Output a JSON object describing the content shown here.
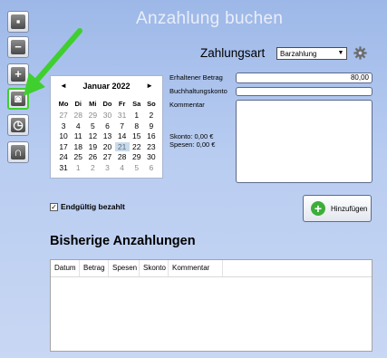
{
  "window": {
    "title": "Anzahlung buchen"
  },
  "toolbar": {
    "buttons": [
      {
        "name": "box-icon",
        "glyph": "▪"
      },
      {
        "name": "minus-icon",
        "glyph": "−"
      },
      {
        "name": "plus-icon",
        "glyph": "+"
      },
      {
        "name": "camera-money-icon",
        "glyph": "◙"
      },
      {
        "name": "clock-icon",
        "glyph": "◷"
      },
      {
        "name": "headset-icon",
        "glyph": "∩"
      }
    ],
    "selected_index": 3,
    "highlight_color": "#3fcf2f"
  },
  "payment": {
    "label": "Zahlungsart",
    "selected": "Barzahlung"
  },
  "calendar": {
    "month_label": "Januar 2022",
    "prev": "◄",
    "next": "►",
    "weekdays": [
      "Mo",
      "Di",
      "Mi",
      "Do",
      "Fr",
      "Sa",
      "So"
    ],
    "days": [
      {
        "d": "27",
        "o": true
      },
      {
        "d": "28",
        "o": true
      },
      {
        "d": "29",
        "o": true
      },
      {
        "d": "30",
        "o": true
      },
      {
        "d": "31",
        "o": true
      },
      {
        "d": "1"
      },
      {
        "d": "2"
      },
      {
        "d": "3"
      },
      {
        "d": "4"
      },
      {
        "d": "5"
      },
      {
        "d": "6"
      },
      {
        "d": "7"
      },
      {
        "d": "8"
      },
      {
        "d": "9"
      },
      {
        "d": "10"
      },
      {
        "d": "11"
      },
      {
        "d": "12"
      },
      {
        "d": "13"
      },
      {
        "d": "14"
      },
      {
        "d": "15"
      },
      {
        "d": "16"
      },
      {
        "d": "17"
      },
      {
        "d": "18"
      },
      {
        "d": "19"
      },
      {
        "d": "20"
      },
      {
        "d": "21",
        "t": true
      },
      {
        "d": "22"
      },
      {
        "d": "23"
      },
      {
        "d": "24"
      },
      {
        "d": "25"
      },
      {
        "d": "26"
      },
      {
        "d": "27"
      },
      {
        "d": "28"
      },
      {
        "d": "29"
      },
      {
        "d": "30"
      },
      {
        "d": "31"
      },
      {
        "d": "1",
        "o": true
      },
      {
        "d": "2",
        "o": true
      },
      {
        "d": "3",
        "o": true
      },
      {
        "d": "4",
        "o": true
      },
      {
        "d": "5",
        "o": true
      },
      {
        "d": "6",
        "o": true
      }
    ]
  },
  "form": {
    "amount_label": "Erhaltener Betrag",
    "amount_value": "80,00",
    "account_label": "Buchhaltungskonto",
    "account_value": "",
    "comment_label": "Kommentar",
    "skonto": "Skonto: 0,00 €",
    "spesen": "Spesen: 0,00 €"
  },
  "final_paid": {
    "label": "Endgültig bezahlt",
    "checked": true
  },
  "add_button": {
    "label": "Hinzufügen"
  },
  "history": {
    "title": "Bisherige Anzahlungen",
    "columns": [
      "Datum",
      "Betrag",
      "Spesen",
      "Skonto",
      "Kommentar"
    ]
  }
}
